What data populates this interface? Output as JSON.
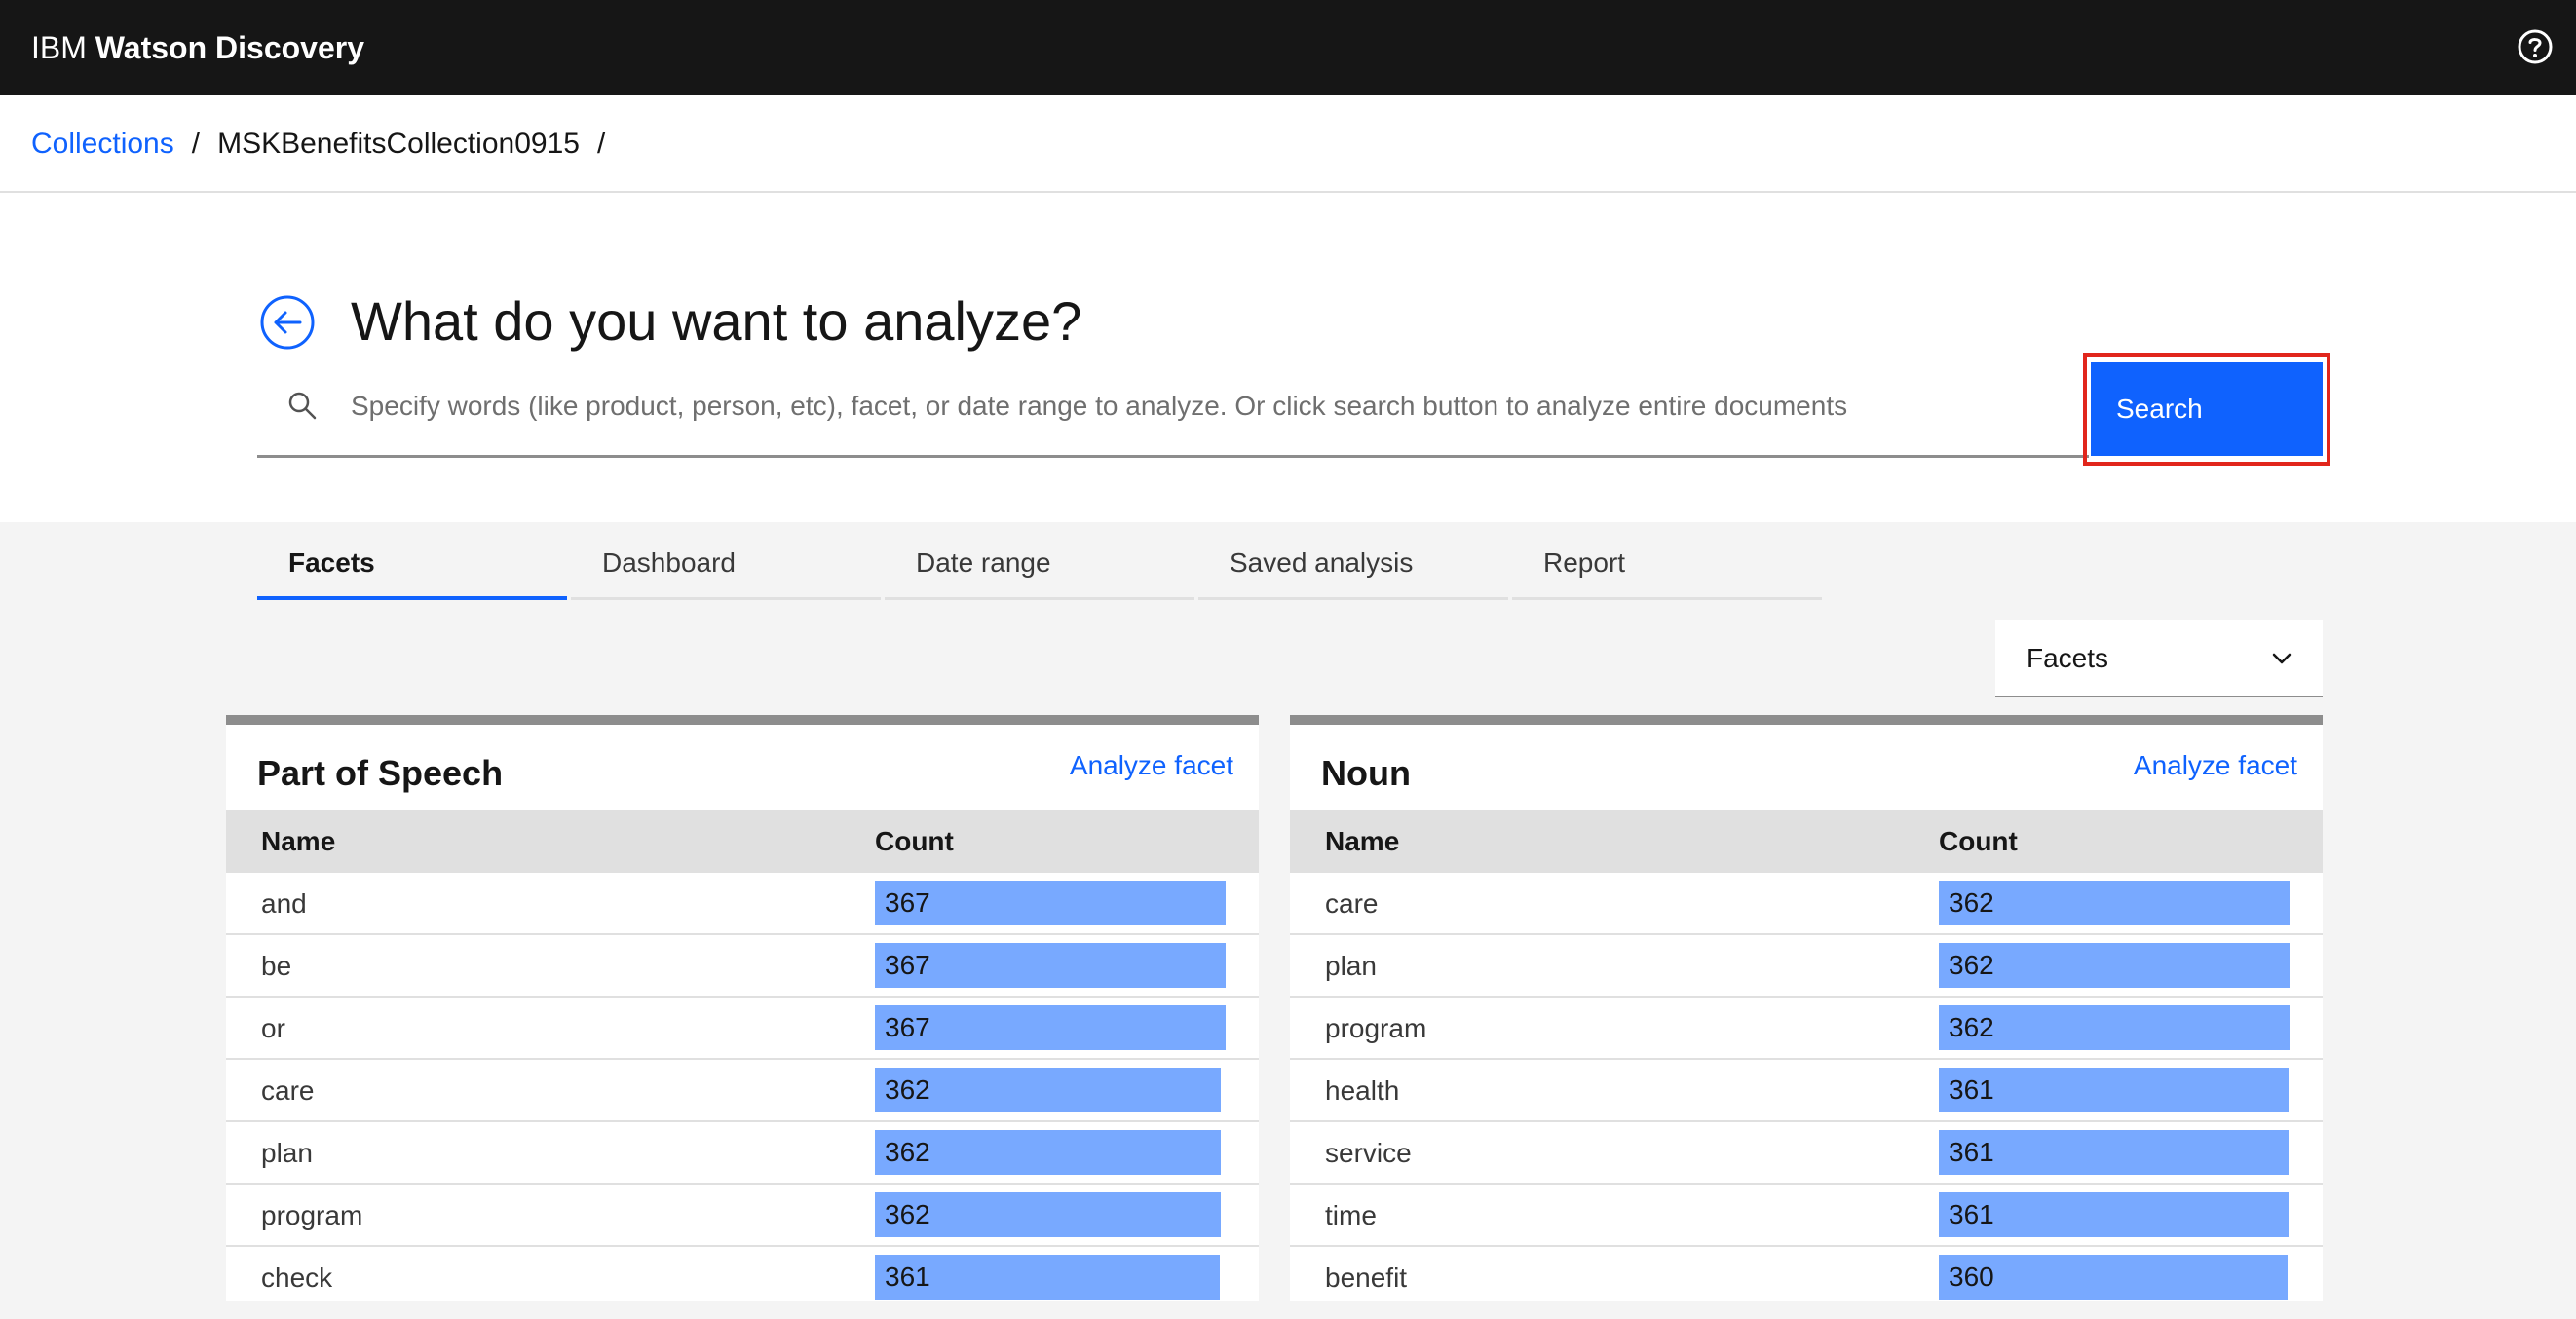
{
  "app": {
    "brand_prefix": "IBM",
    "brand_name": "Watson Discovery",
    "help_icon": "help-icon"
  },
  "breadcrumb": {
    "items": [
      {
        "label": "Collections"
      },
      {
        "label": "MSKBenefitsCollection0915"
      }
    ],
    "separator": "/"
  },
  "hero": {
    "title": "What do you want to analyze?",
    "search_placeholder": "Specify words (like product, person, etc), facet, or date range to analyze. Or click search button to analyze entire documents",
    "search_value": "",
    "search_button": "Search"
  },
  "tabs": [
    {
      "label": "Facets",
      "active": true
    },
    {
      "label": "Dashboard",
      "active": false
    },
    {
      "label": "Date range",
      "active": false
    },
    {
      "label": "Saved analysis",
      "active": false
    },
    {
      "label": "Report",
      "active": false
    }
  ],
  "facet_select": {
    "selected": "Facets"
  },
  "colors": {
    "accent": "#0f62fe",
    "bar": "#78a9ff",
    "topbar": "#161616",
    "highlight": "#e1261c"
  },
  "cards": [
    {
      "title": "Part of Speech",
      "action": "Analyze facet",
      "columns": {
        "name": "Name",
        "count": "Count"
      },
      "rows": [
        {
          "name": "and",
          "count": "367",
          "fill": 1.0
        },
        {
          "name": "be",
          "count": "367",
          "fill": 1.0
        },
        {
          "name": "or",
          "count": "367",
          "fill": 1.0
        },
        {
          "name": "care",
          "count": "362",
          "fill": 0.986
        },
        {
          "name": "plan",
          "count": "362",
          "fill": 0.986
        },
        {
          "name": "program",
          "count": "362",
          "fill": 0.986
        },
        {
          "name": "check",
          "count": "361",
          "fill": 0.984
        }
      ]
    },
    {
      "title": "Noun",
      "action": "Analyze facet",
      "columns": {
        "name": "Name",
        "count": "Count"
      },
      "rows": [
        {
          "name": "care",
          "count": "362",
          "fill": 1.0
        },
        {
          "name": "plan",
          "count": "362",
          "fill": 1.0
        },
        {
          "name": "program",
          "count": "362",
          "fill": 1.0
        },
        {
          "name": "health",
          "count": "361",
          "fill": 0.997
        },
        {
          "name": "service",
          "count": "361",
          "fill": 0.997
        },
        {
          "name": "time",
          "count": "361",
          "fill": 0.997
        },
        {
          "name": "benefit",
          "count": "360",
          "fill": 0.994
        }
      ]
    }
  ]
}
